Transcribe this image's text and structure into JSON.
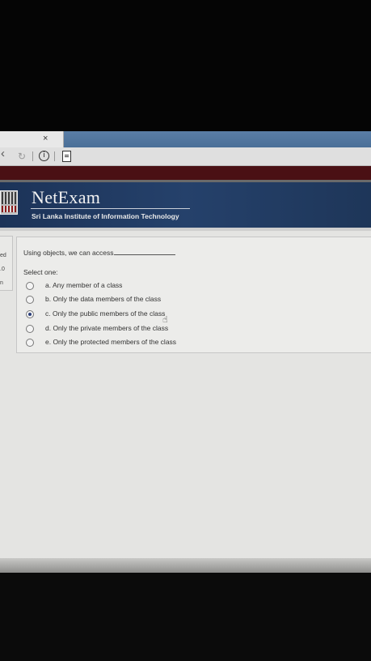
{
  "browser": {
    "tab_close": "×",
    "back_icon": "‹",
    "reload_icon": "↻",
    "info_icon": "i"
  },
  "header": {
    "brand": "NetExam",
    "subtitle": "Sri Lanka Institute of Information Technology"
  },
  "sidebar": {
    "fragments": [
      "ed",
      ".0",
      "n"
    ]
  },
  "quiz": {
    "question": "Using objects, we can access",
    "select_label": "Select one:",
    "options": [
      {
        "label": "a. Any member of a class",
        "selected": false
      },
      {
        "label": "b. Only the data members of the class",
        "selected": false
      },
      {
        "label": "c. Only the public members of the class",
        "selected": true
      },
      {
        "label": "d. Only the private members of the class",
        "selected": false
      },
      {
        "label": "e. Only the protected members of the class",
        "selected": false
      }
    ]
  },
  "colors": {
    "banner": "#25416b",
    "darkband": "#4a1014",
    "tabstrip": "#4a6f98"
  }
}
